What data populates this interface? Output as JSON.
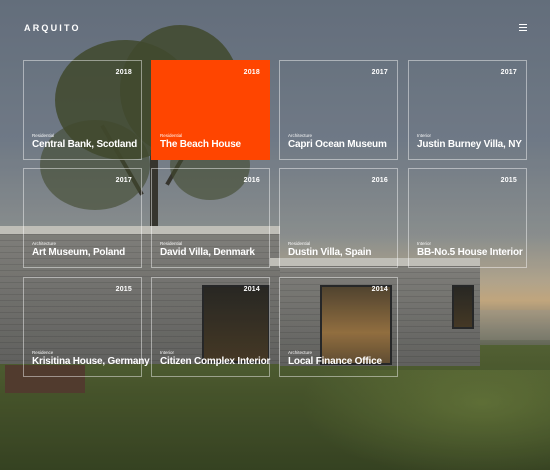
{
  "header": {
    "logo": "ARQUITO",
    "menu_icon": "hamburger-icon"
  },
  "colors": {
    "accent": "#ff4500",
    "text": "#ffffff"
  },
  "projects": [
    {
      "category": "Residential",
      "title": "Central Bank, Scotland",
      "year": "2018",
      "active": false
    },
    {
      "category": "Residential",
      "title": "The Beach House",
      "year": "2018",
      "active": true
    },
    {
      "category": "Architecture",
      "title": "Capri Ocean Museum",
      "year": "2017",
      "active": false
    },
    {
      "category": "Interior",
      "title": "Justin Burney Villa, NY",
      "year": "2017",
      "active": false
    },
    {
      "category": "Architecture",
      "title": "Art Museum, Poland",
      "year": "2017",
      "active": false
    },
    {
      "category": "Residential",
      "title": "David Villa, Denmark",
      "year": "2016",
      "active": false
    },
    {
      "category": "Residential",
      "title": "Dustin Villa, Spain",
      "year": "2016",
      "active": false
    },
    {
      "category": "Interior",
      "title": "BB-No.5 House Interior",
      "year": "2015",
      "active": false
    },
    {
      "category": "Residence",
      "title": "Krisitina House, Germany",
      "year": "2015",
      "active": false
    },
    {
      "category": "Interior",
      "title": "Citizen Complex Interior",
      "year": "2014",
      "active": false
    },
    {
      "category": "Architecture",
      "title": "Local Finance Office",
      "year": "2014",
      "active": false
    }
  ]
}
